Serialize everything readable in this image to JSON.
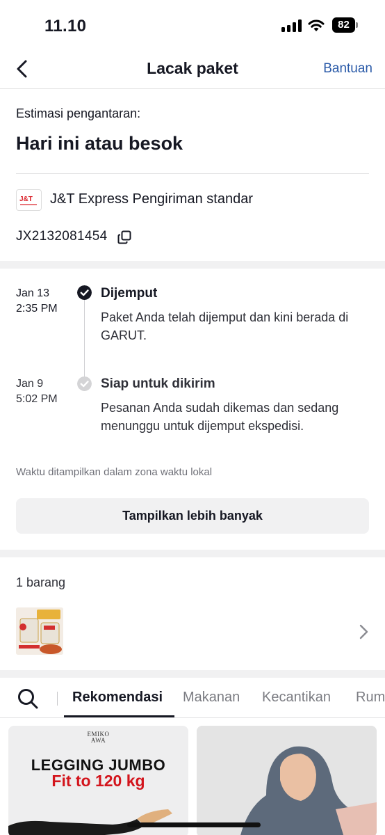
{
  "status_bar": {
    "time": "11.10",
    "battery": "82"
  },
  "nav": {
    "title": "Lacak paket",
    "help": "Bantuan"
  },
  "delivery": {
    "estimate_label": "Estimasi pengantaran:",
    "estimate_value": "Hari ini atau besok",
    "courier": "J&T Express Pengiriman standar",
    "tracking_number": "JX2132081454"
  },
  "timeline": {
    "events": [
      {
        "date": "Jan 13",
        "time": "2:35 PM",
        "title": "Dijemput",
        "desc": "Paket Anda telah dijemput dan kini berada di GARUT."
      },
      {
        "date": "Jan 9",
        "time": "5:02 PM",
        "title": "Siap untuk dikirim",
        "desc": "Pesanan Anda sudah dikemas dan sedang menunggu untuk dijemput ekspedisi."
      }
    ],
    "timezone_note": "Waktu ditampilkan dalam zona waktu lokal",
    "more_button": "Tampilkan lebih banyak"
  },
  "items": {
    "count_label": "1 barang"
  },
  "tabs": [
    "Rekomendasi",
    "Makanan",
    "Kecantikan",
    "Rum"
  ],
  "cards": {
    "card1": {
      "brand_line1": "EMIKO",
      "brand_line2": "AWA",
      "headline": "LEGGING JUMBO",
      "subline": "Fit to 120 kg"
    }
  },
  "colors": {
    "accent_link": "#2a5aa8",
    "text": "#161823",
    "divider": "#f1f1f2"
  }
}
